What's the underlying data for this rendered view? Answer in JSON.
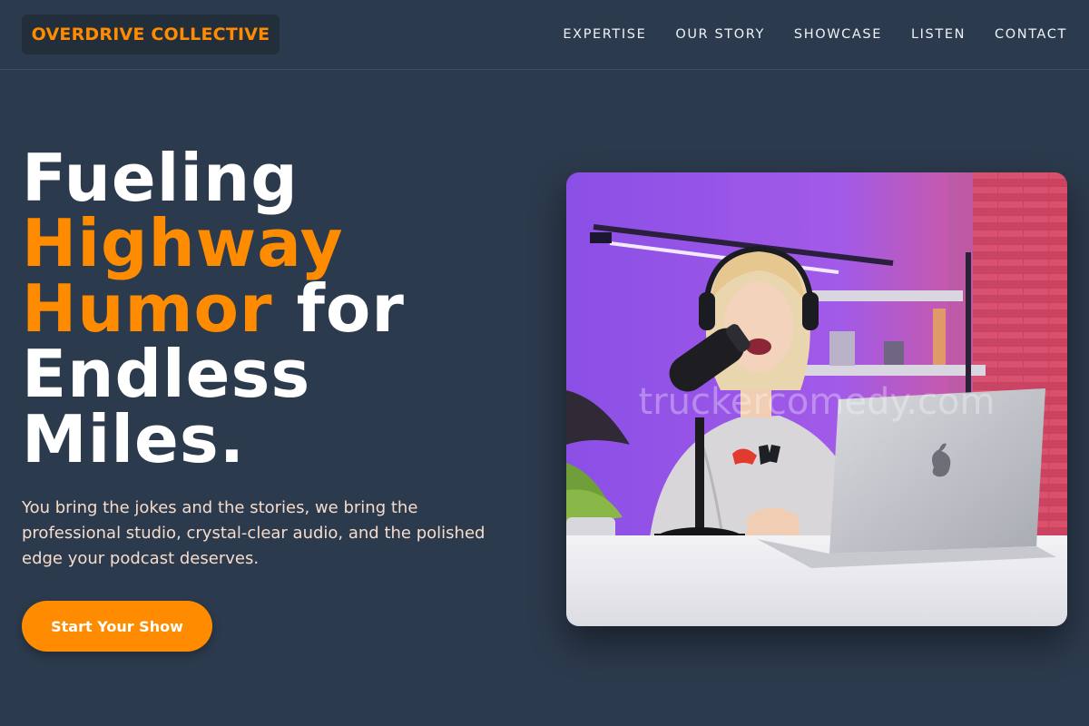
{
  "brand": {
    "name": "OVERDRIVE COLLECTIVE"
  },
  "nav": {
    "items": [
      "EXPERTISE",
      "OUR STORY",
      "SHOWCASE",
      "LISTEN",
      "CONTACT"
    ]
  },
  "hero": {
    "headline": {
      "line1": "Fueling",
      "line2_accent": "Highway",
      "line3_accent": "Humor",
      "line3_rest": " for",
      "line4": "Endless",
      "line5": "Miles."
    },
    "description": "You bring the jokes and the stories, we bring the professional studio, crystal-clear audio, and the polished edge your podcast deserves.",
    "cta_label": "Start Your Show",
    "image_watermark": "truckercomedy.com"
  },
  "colors": {
    "accent": "#ff8c00",
    "background": "#2c3a4d",
    "logo_bg": "#232e3b",
    "lede": "#f6dccb"
  }
}
